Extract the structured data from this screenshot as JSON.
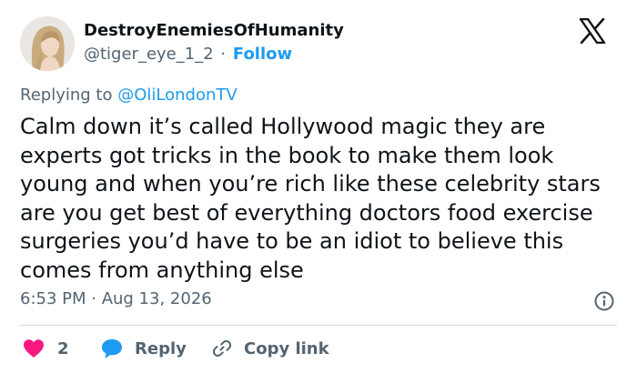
{
  "author": {
    "display_name": "DestroyEnemiesOfHumanity",
    "handle": "@tiger_eye_1_2",
    "separator": "·",
    "follow_label": "Follow"
  },
  "reply_context": {
    "prefix": "Replying to",
    "mention": "@OliLondonTV"
  },
  "tweet": {
    "text": "Calm down it’s called Hollywood magic they are experts got tricks in the book to make them look young and when you’re rich like these celebrity stars are you get best of everything doctors food exercise surgeries you’d have to be an idiot to believe this comes from anything else",
    "timestamp": "6:53 PM · Aug 13, 2026"
  },
  "actions": {
    "like_count": "2",
    "reply_label": "Reply",
    "copy_link_label": "Copy link"
  },
  "icons": {
    "brand": "x-logo-icon",
    "info": "info-icon",
    "like": "heart-icon",
    "reply": "speech-bubble-icon",
    "copy": "link-icon"
  },
  "colors": {
    "accent": "#1d9bf0",
    "like": "#f91880",
    "text": "#0f1419",
    "muted": "#536471",
    "divider": "#cfd9de"
  }
}
